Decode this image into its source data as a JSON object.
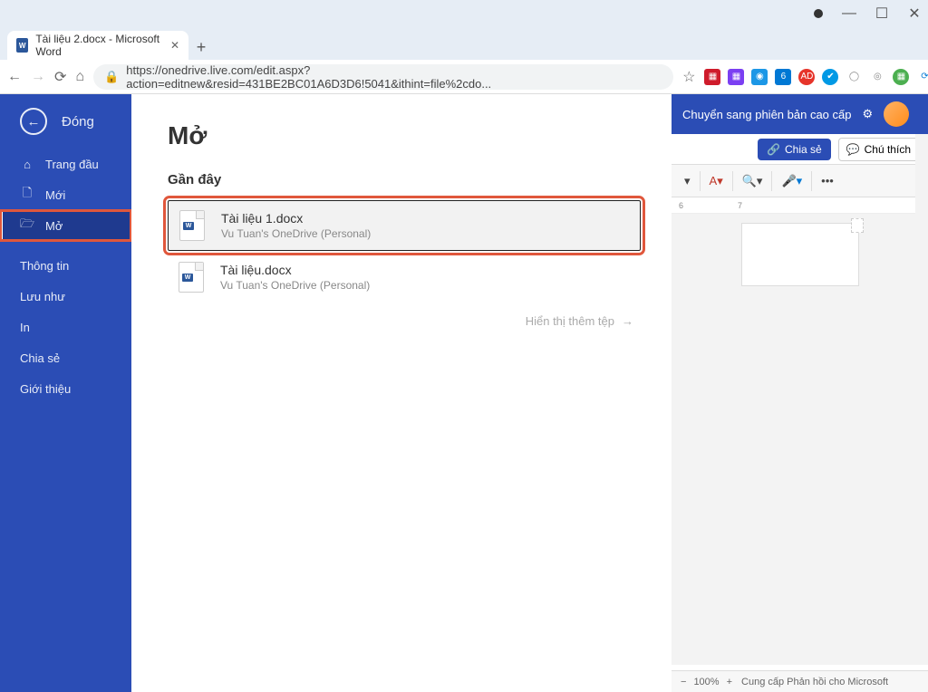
{
  "window": {
    "minimize": "—",
    "maximize": "☐",
    "close": "✕"
  },
  "browser": {
    "tab_title": "Tài liệu 2.docx - Microsoft Word",
    "url": "https://onedrive.live.com/edit.aspx?action=editnew&resid=431BE2BC01A6D3D6!5041&ithint=file%2cdo...",
    "star": "☆"
  },
  "app_header": {
    "upgrade": "Chuyển sang phiên bản cao cấp",
    "share": "Chia sẻ",
    "comment": "Chú thích"
  },
  "ruler": {
    "a": "6",
    "b": "7"
  },
  "backstage": {
    "close": "Đóng",
    "items": [
      {
        "label": "Trang đầu"
      },
      {
        "label": "Mới"
      },
      {
        "label": "Mở"
      },
      {
        "label": "Thông tin"
      },
      {
        "label": "Lưu như"
      },
      {
        "label": "In"
      },
      {
        "label": "Chia sẻ"
      },
      {
        "label": "Giới thiệu"
      }
    ],
    "title": "Mở",
    "section": "Gần đây",
    "files": [
      {
        "name": "Tài liệu 1.docx",
        "loc": "Vu Tuan's OneDrive (Personal)"
      },
      {
        "name": "Tài liệu.docx",
        "loc": "Vu Tuan's OneDrive (Personal)"
      }
    ],
    "show_more": "Hiển thị thêm tệp"
  },
  "status": {
    "zoom": "100%",
    "feedback": "Cung cấp Phản hồi cho Microsoft"
  }
}
